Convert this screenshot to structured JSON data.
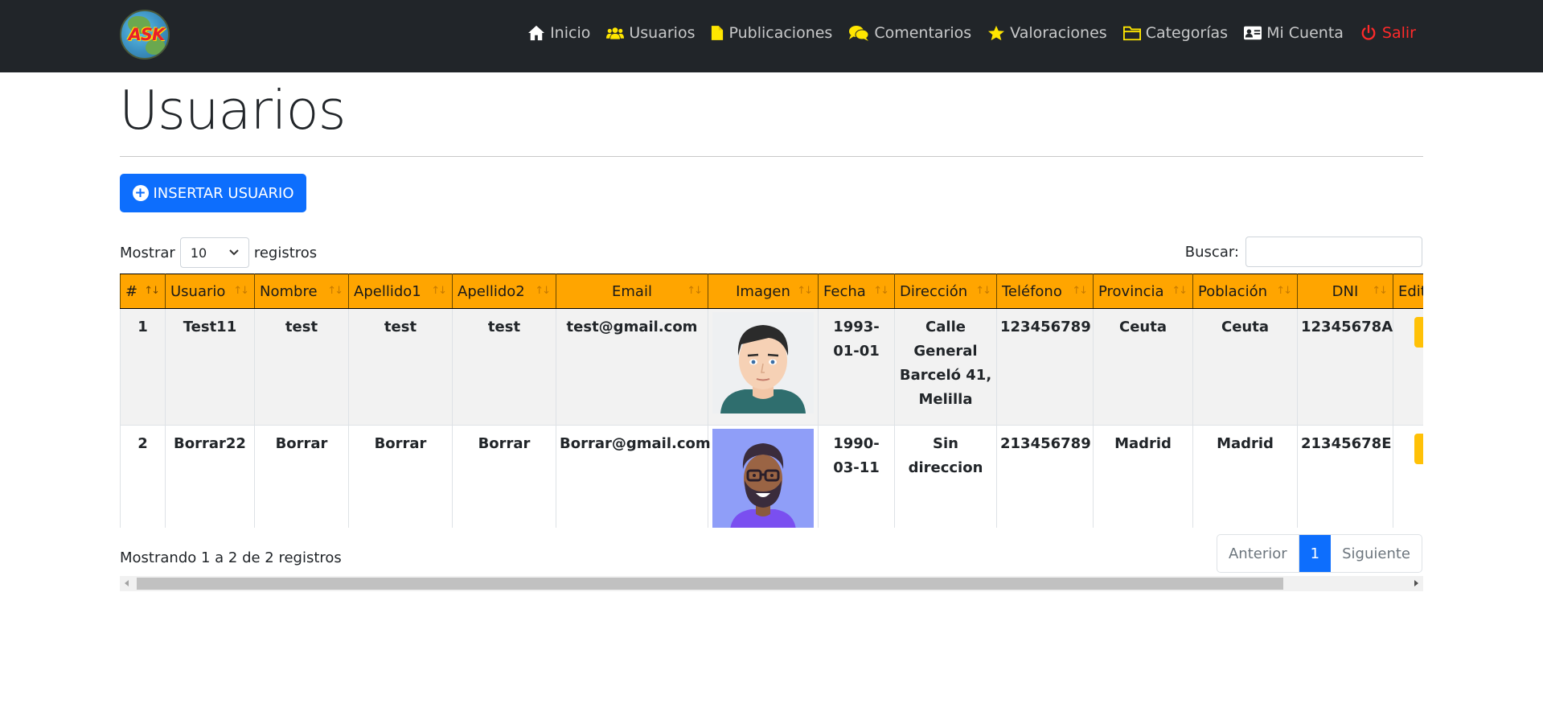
{
  "nav": {
    "items": [
      {
        "label": "Inicio",
        "icon": "house-icon"
      },
      {
        "label": "Usuarios",
        "icon": "users-icon"
      },
      {
        "label": "Publicaciones",
        "icon": "file-icon"
      },
      {
        "label": "Comentarios",
        "icon": "comments-icon"
      },
      {
        "label": "Valoraciones",
        "icon": "star-icon"
      },
      {
        "label": "Categorías",
        "icon": "folder-icon"
      },
      {
        "label": "Mi Cuenta",
        "icon": "id-card-icon"
      },
      {
        "label": "Salir",
        "icon": "power-icon"
      }
    ],
    "logo_text": "ASK"
  },
  "page": {
    "title": "Usuarios",
    "insert_label": "INSERTAR USUARIO"
  },
  "controls": {
    "show_label": "Mostrar",
    "length_value": "10",
    "records_label": "registros",
    "search_label": "Buscar:",
    "search_value": ""
  },
  "table": {
    "headers": [
      "#",
      "Usuario",
      "Nombre",
      "Apellido1",
      "Apellido2",
      "Email",
      "Imagen",
      "Fecha",
      "Dirección",
      "Teléfono",
      "Provincia",
      "Población",
      "DNI",
      "Editar"
    ],
    "rows": [
      {
        "id": "1",
        "usuario": "Test11",
        "nombre": "test",
        "apellido1": "test",
        "apellido2": "test",
        "email": "test@gmail.com",
        "imagen": "avatar-man-icon",
        "fecha": "1993-01-01",
        "direccion": "Calle General Barceló 41, Melilla",
        "telefono": "123456789",
        "provincia": "Ceuta",
        "poblacion": "Ceuta",
        "dni": "12345678A"
      },
      {
        "id": "2",
        "usuario": "Borrar22",
        "nombre": "Borrar",
        "apellido1": "Borrar",
        "apellido2": "Borrar",
        "email": "Borrar@gmail.com",
        "imagen": "avatar-bearded-icon",
        "fecha": "1990-03-11",
        "direccion": "Sin direccion",
        "telefono": "213456789",
        "provincia": "Madrid",
        "poblacion": "Madrid",
        "dni": "21345678E"
      }
    ]
  },
  "footer": {
    "info": "Mostrando 1 a 2 de 2 registros",
    "prev": "Anterior",
    "page": "1",
    "next": "Siguiente"
  },
  "colors": {
    "navbar": "#212529",
    "primary": "#0d6efd",
    "header": "#ffa500",
    "salir": "#ff2a2a",
    "edit": "#ffc107"
  }
}
